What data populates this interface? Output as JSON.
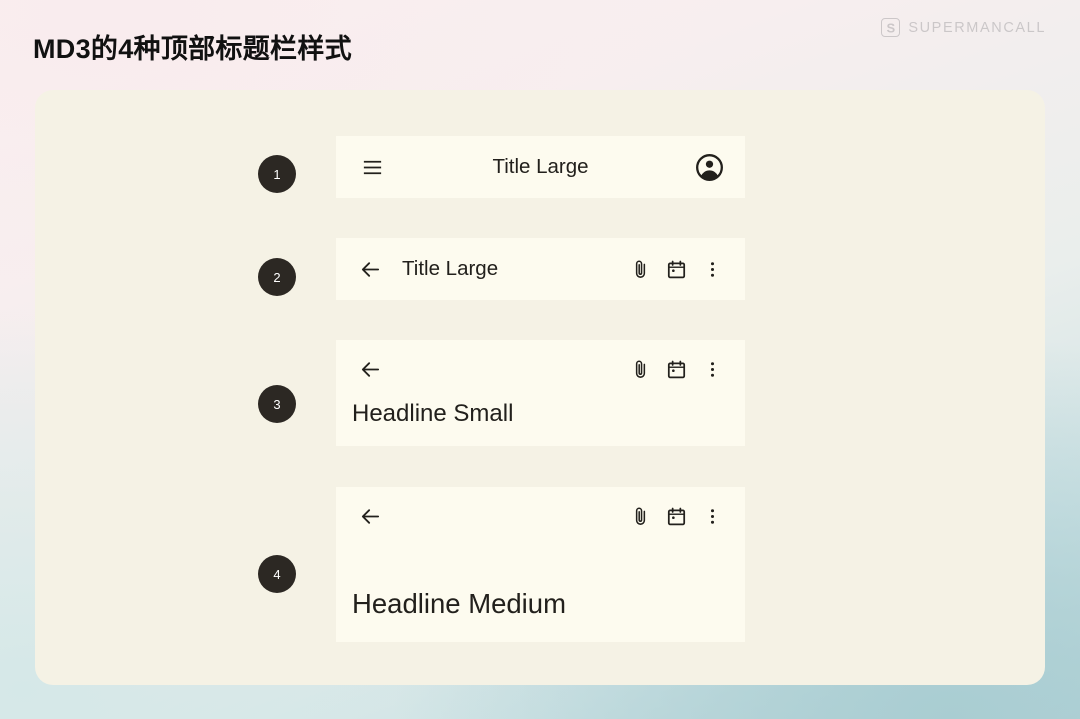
{
  "header": {
    "title": "MD3的4种顶部标题栏样式",
    "watermark": {
      "logo_icon": "supermancall-s-logo-icon",
      "text": "SUPERMANCALL"
    }
  },
  "colors": {
    "page_gradient_top_left": "#fbf1f1",
    "page_gradient_bottom_right": "#b6d4d8",
    "stage_background": "#f5f2e5",
    "appbar_background": "#fdfbef",
    "badge_background": "#2c2823",
    "text_primary": "#22201c",
    "title_color": "#111111",
    "watermark_color": "#6f6f73"
  },
  "appbars": [
    {
      "number": "1",
      "variant": "center-aligned",
      "leading_icon": "menu-icon",
      "title": "Title Large",
      "title_align": "center",
      "trailing_icons": [
        "account-circle-icon"
      ]
    },
    {
      "number": "2",
      "variant": "small",
      "leading_icon": "arrow-back-icon",
      "title": "Title Large",
      "title_align": "left",
      "trailing_icons": [
        "attach-file-icon",
        "calendar-icon",
        "more-vert-icon"
      ]
    },
    {
      "number": "3",
      "variant": "medium",
      "leading_icon": "arrow-back-icon",
      "title": "Headline Small",
      "title_align": "left",
      "trailing_icons": [
        "attach-file-icon",
        "calendar-icon",
        "more-vert-icon"
      ]
    },
    {
      "number": "4",
      "variant": "large",
      "leading_icon": "arrow-back-icon",
      "title": "Headline Medium",
      "title_align": "left",
      "trailing_icons": [
        "attach-file-icon",
        "calendar-icon",
        "more-vert-icon"
      ]
    }
  ]
}
